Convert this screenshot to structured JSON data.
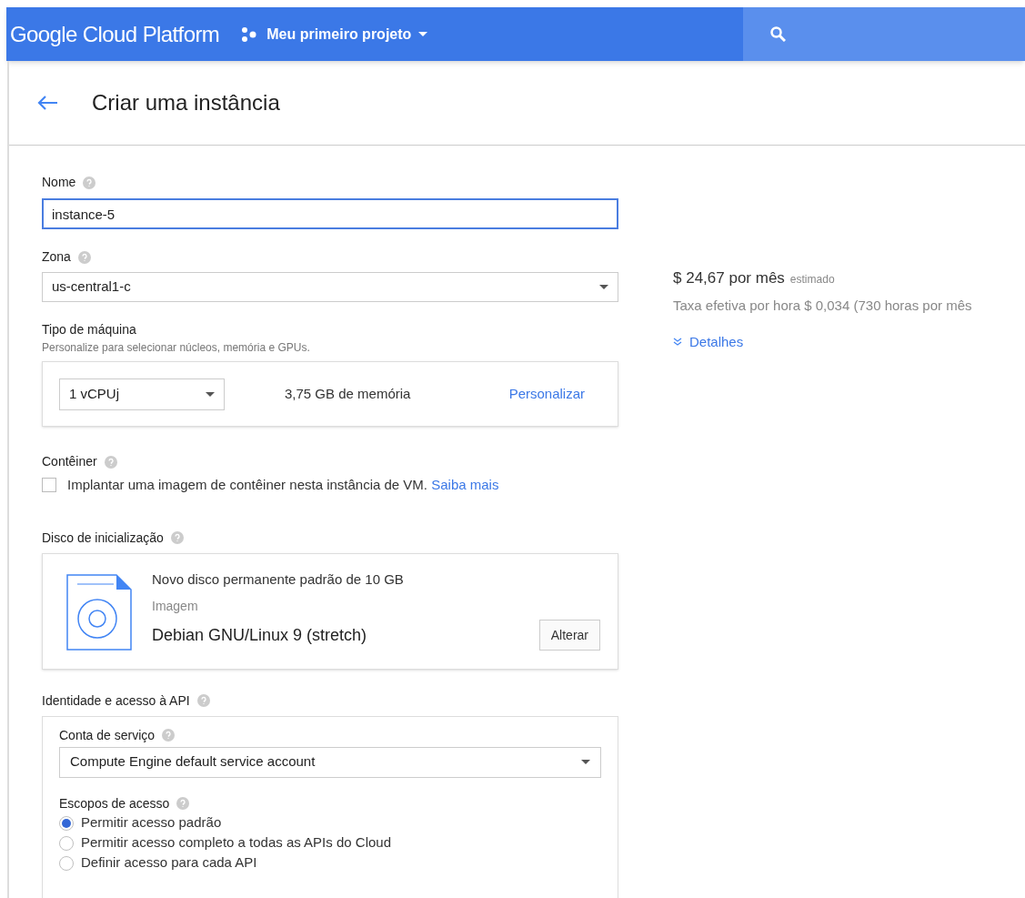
{
  "top_bar": {
    "brand": "Google Cloud Platform",
    "project": "Meu primeiro projeto"
  },
  "page_title": "Criar uma instância",
  "name_field": {
    "label": "Nome",
    "value": "instance-5"
  },
  "zone": {
    "label": "Zona",
    "value": "us-central1-c"
  },
  "machine_type": {
    "label": "Tipo de máquina",
    "hint": "Personalize para selecionar núcleos, memória e GPUs.",
    "cpu": "1 vCPUj",
    "memory": "3,75 GB de memória",
    "customize": "Personalizar"
  },
  "container": {
    "label": "Contêiner",
    "checkbox_label": "Implantar uma imagem de contêiner nesta instância de VM.",
    "link": "Saiba mais",
    "checked": false
  },
  "boot_disk": {
    "label": "Disco de inicialização",
    "title": "Novo disco permanente padrão de 10 GB",
    "image_label": "Imagem",
    "image": "Debian GNU/Linux 9 (stretch)",
    "change": "Alterar"
  },
  "identity": {
    "label": "Identidade e acesso à API",
    "service_account_label": "Conta de serviço",
    "service_account": "Compute Engine default service account",
    "scopes_label": "Escopos de acesso",
    "scopes": [
      {
        "label": "Permitir acesso padrão",
        "selected": true
      },
      {
        "label": "Permitir acesso completo a todas as APIs do Cloud",
        "selected": false
      },
      {
        "label": "Definir acesso para cada API",
        "selected": false
      }
    ]
  },
  "pricing": {
    "price": "$ 24,67 por mês",
    "estimate": "estimado",
    "hourly": "Taxa efetiva por hora $ 0,034 (730 horas por mês",
    "details": "Detalhes"
  }
}
